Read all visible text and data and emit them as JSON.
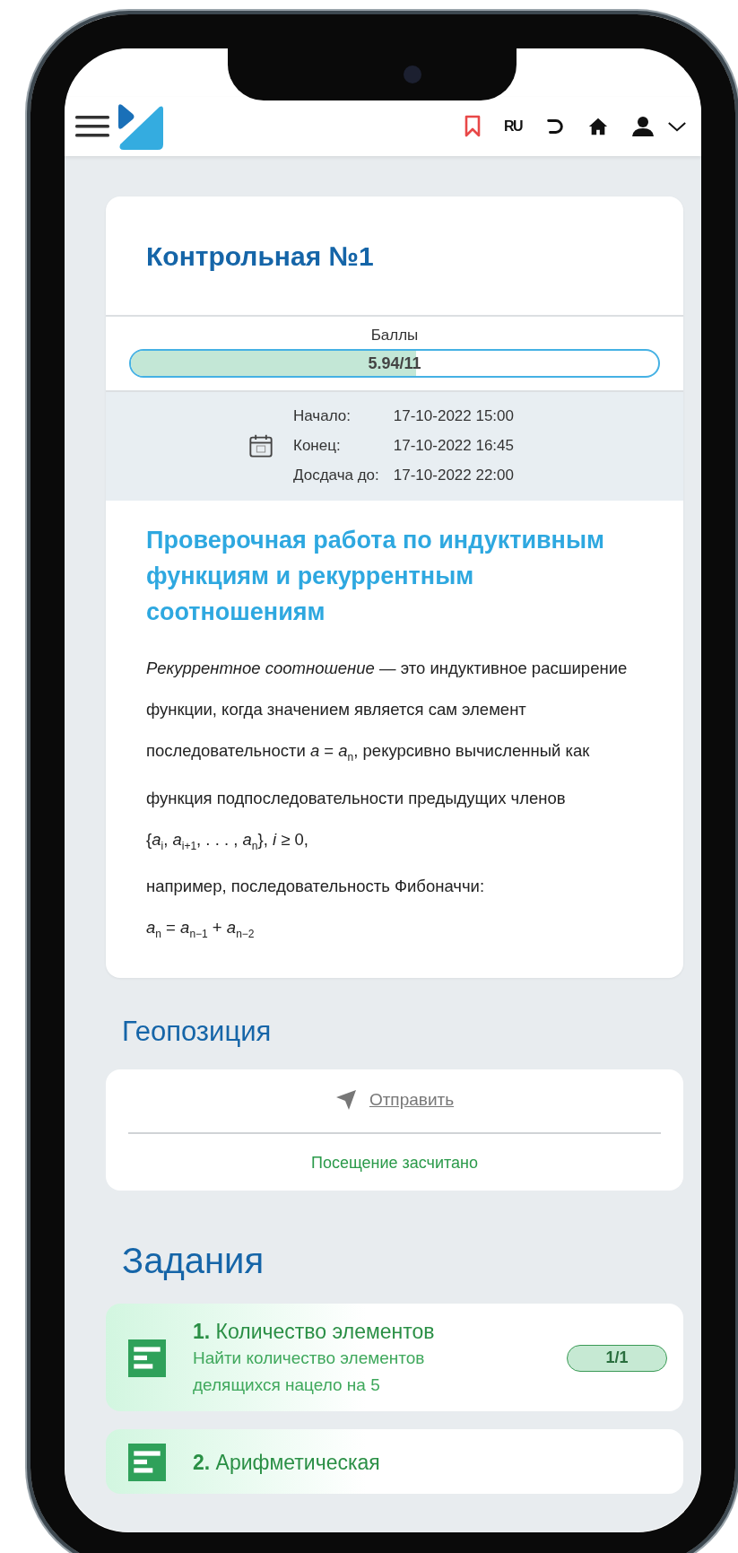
{
  "header": {
    "language": "RU"
  },
  "test": {
    "title": "Контрольная №1",
    "score_label": "Баллы",
    "score": {
      "text": "5.94/11",
      "level": 0.54
    },
    "dates": [
      {
        "label": "Начало:",
        "value": "17-10-2022 15:00"
      },
      {
        "label": "Конец:",
        "value": "17-10-2022 16:45"
      },
      {
        "label": "Досдача до:",
        "value": "17-10-2022 22:00"
      }
    ],
    "section_title": "Проверочная работа по индуктивным функциям и рекуррентным соотношениям",
    "paragraphs": [
      "*Рекуррентное соотношение* — это индуктивное расширение функции, когда значением является сам элемент последовательности *a* = *a*$_{n}$, рекурсивно вычисленный как функция подпоследовательности предыдущих членов",
      "{*a*$_{i}$, *a*$_{i+1}$, . . . , *a*$_{n}$}, *i* ≥ 0,",
      "например, последовательность Фибоначчи:",
      "*a*$_{n}$ = *a*$_{n−1}$ + *a*$_{n−2}$"
    ]
  },
  "geo": {
    "heading": "Геопозиция",
    "send_link": "Отправить",
    "status": "Посещение засчитано"
  },
  "tasks_heading": "Задания",
  "tasks": [
    {
      "title": "**1.** Количество элементов",
      "description": "Найти количество элементов делящихся нацело на 5",
      "score": "1/1"
    },
    {
      "title": "**2.** Арифметическая"
    }
  ]
}
